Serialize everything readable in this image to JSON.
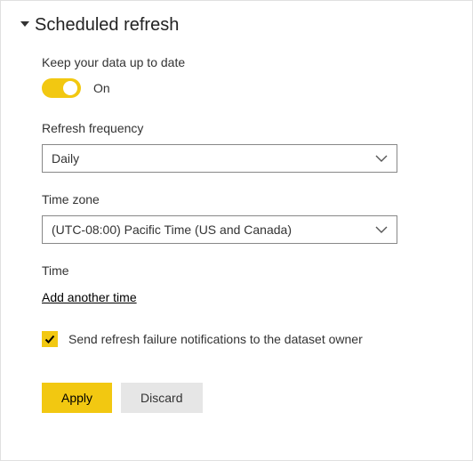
{
  "section": {
    "title": "Scheduled refresh"
  },
  "keepUpToDate": {
    "label": "Keep your data up to date",
    "stateText": "On"
  },
  "frequency": {
    "label": "Refresh frequency",
    "value": "Daily"
  },
  "timezone": {
    "label": "Time zone",
    "value": "(UTC-08:00) Pacific Time (US and Canada)"
  },
  "time": {
    "label": "Time",
    "addLink": "Add another time"
  },
  "notify": {
    "label": "Send refresh failure notifications to the dataset owner"
  },
  "buttons": {
    "apply": "Apply",
    "discard": "Discard"
  }
}
